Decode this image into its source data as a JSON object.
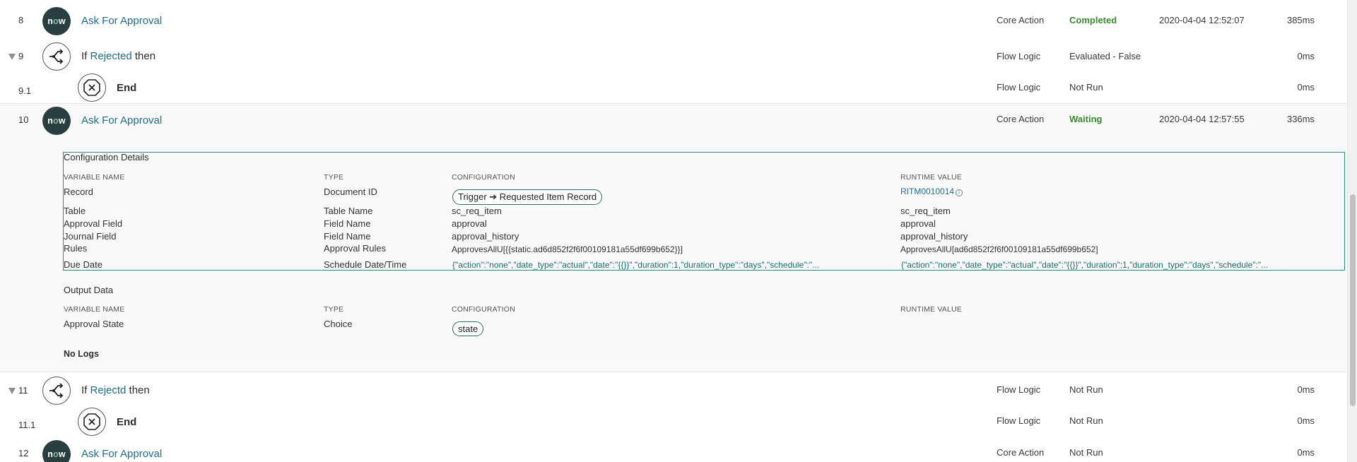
{
  "rows": {
    "r8": {
      "num": "8",
      "title": "Ask For Approval",
      "type": "Core Action",
      "status": "Completed",
      "time": "2020-04-04 12:52:07",
      "duration": "385ms"
    },
    "r9": {
      "num": "9",
      "prefix": "If",
      "keyword": "Rejected",
      "suffix": "then",
      "type": "Flow Logic",
      "status": "Evaluated - False",
      "duration": "0ms"
    },
    "r91": {
      "num": "9.1",
      "title": "End",
      "type": "Flow Logic",
      "status": "Not Run",
      "duration": "0ms"
    },
    "r10": {
      "num": "10",
      "title": "Ask For Approval",
      "type": "Core Action",
      "status": "Waiting",
      "time": "2020-04-04 12:57:55",
      "duration": "336ms"
    },
    "r11": {
      "num": "11",
      "prefix": "If",
      "keyword": "Rejectd",
      "suffix": "then",
      "type": "Flow Logic",
      "status": "Not Run",
      "duration": "0ms"
    },
    "r111": {
      "num": "11.1",
      "title": "End",
      "type": "Flow Logic",
      "status": "Not Run",
      "duration": "0ms"
    },
    "r12": {
      "num": "12",
      "title": "Ask For Approval",
      "type": "Core Action",
      "status": "Not Run",
      "duration": "0ms"
    }
  },
  "icons": {
    "now_a": "n",
    "now_b": "o",
    "now_c": "w"
  },
  "config": {
    "title": "Configuration Details",
    "headers": {
      "name": "VARIABLE NAME",
      "type": "TYPE",
      "config": "CONFIGURATION",
      "runtime": "RUNTIME VALUE"
    },
    "rows": [
      {
        "name": "Record",
        "type": "Document ID",
        "config": "Trigger ➔ Requested Item Record",
        "runtime": "RITM0010014"
      },
      {
        "name": "Table",
        "type": "Table Name",
        "config": "sc_req_item",
        "runtime": "sc_req_item"
      },
      {
        "name": "Approval Field",
        "type": "Field Name",
        "config": "approval",
        "runtime": "approval"
      },
      {
        "name": "Journal Field",
        "type": "Field Name",
        "config": "approval_history",
        "runtime": "approval_history"
      },
      {
        "name": "Rules",
        "type": "Approval Rules",
        "config": "ApprovesAllU[{{static.ad6d852f2f6f00109181a55df699b652}}]",
        "runtime": "ApprovesAllU[ad6d852f2f6f00109181a55df699b652]"
      },
      {
        "name": "Due Date",
        "type": "Schedule Date/Time",
        "config": "{\"action\":\"none\",\"date_type\":\"actual\",\"date\":\"{{}}\",\"duration\":1,\"duration_type\":\"days\",\"schedule\":\"...",
        "runtime": "{\"action\":\"none\",\"date_type\":\"actual\",\"date\":\"{{}}\",\"duration\":1,\"duration_type\":\"days\",\"schedule\":\"..."
      }
    ],
    "info_icon": "i"
  },
  "output": {
    "title": "Output Data",
    "headers": {
      "name": "VARIABLE NAME",
      "type": "TYPE",
      "config": "CONFIGURATION",
      "runtime": "RUNTIME VALUE"
    },
    "rows": [
      {
        "name": "Approval State",
        "type": "Choice",
        "config": "state",
        "runtime": ""
      }
    ]
  },
  "logs": {
    "label": "No Logs"
  },
  "colors": {
    "accent": "#1f6f86",
    "success": "#3a8a2e",
    "border": "#2f8f7f",
    "icon_bg": "#293e40"
  }
}
